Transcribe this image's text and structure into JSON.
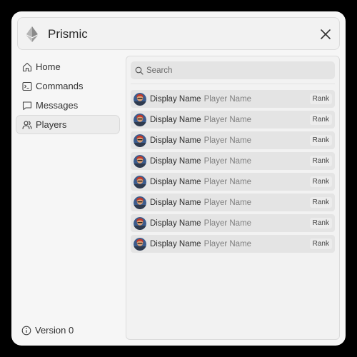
{
  "app": {
    "title": "Prismic",
    "logo_icon": "ethereum-logo-icon",
    "close_icon": "close-icon"
  },
  "sidebar": {
    "items": [
      {
        "label": "Home",
        "icon": "home-icon"
      },
      {
        "label": "Commands",
        "icon": "terminal-icon"
      },
      {
        "label": "Messages",
        "icon": "message-icon"
      },
      {
        "label": "Players",
        "icon": "users-icon",
        "active": true
      }
    ],
    "version": {
      "label": "Version 0",
      "icon": "info-icon"
    }
  },
  "search": {
    "placeholder": "Search",
    "value": ""
  },
  "players": [
    {
      "display_name": "Display Name",
      "player_name": "Player Name",
      "rank": "Rank"
    },
    {
      "display_name": "Display Name",
      "player_name": "Player Name",
      "rank": "Rank"
    },
    {
      "display_name": "Display Name",
      "player_name": "Player Name",
      "rank": "Rank"
    },
    {
      "display_name": "Display Name",
      "player_name": "Player Name",
      "rank": "Rank"
    },
    {
      "display_name": "Display Name",
      "player_name": "Player Name",
      "rank": "Rank"
    },
    {
      "display_name": "Display Name",
      "player_name": "Player Name",
      "rank": "Rank"
    },
    {
      "display_name": "Display Name",
      "player_name": "Player Name",
      "rank": "Rank"
    },
    {
      "display_name": "Display Name",
      "player_name": "Player Name",
      "rank": "Rank"
    }
  ],
  "colors": {
    "accent_active_bg": "#ececec",
    "row_bg": "#e4e4e4",
    "panel_bg": "#f2f2f2"
  }
}
